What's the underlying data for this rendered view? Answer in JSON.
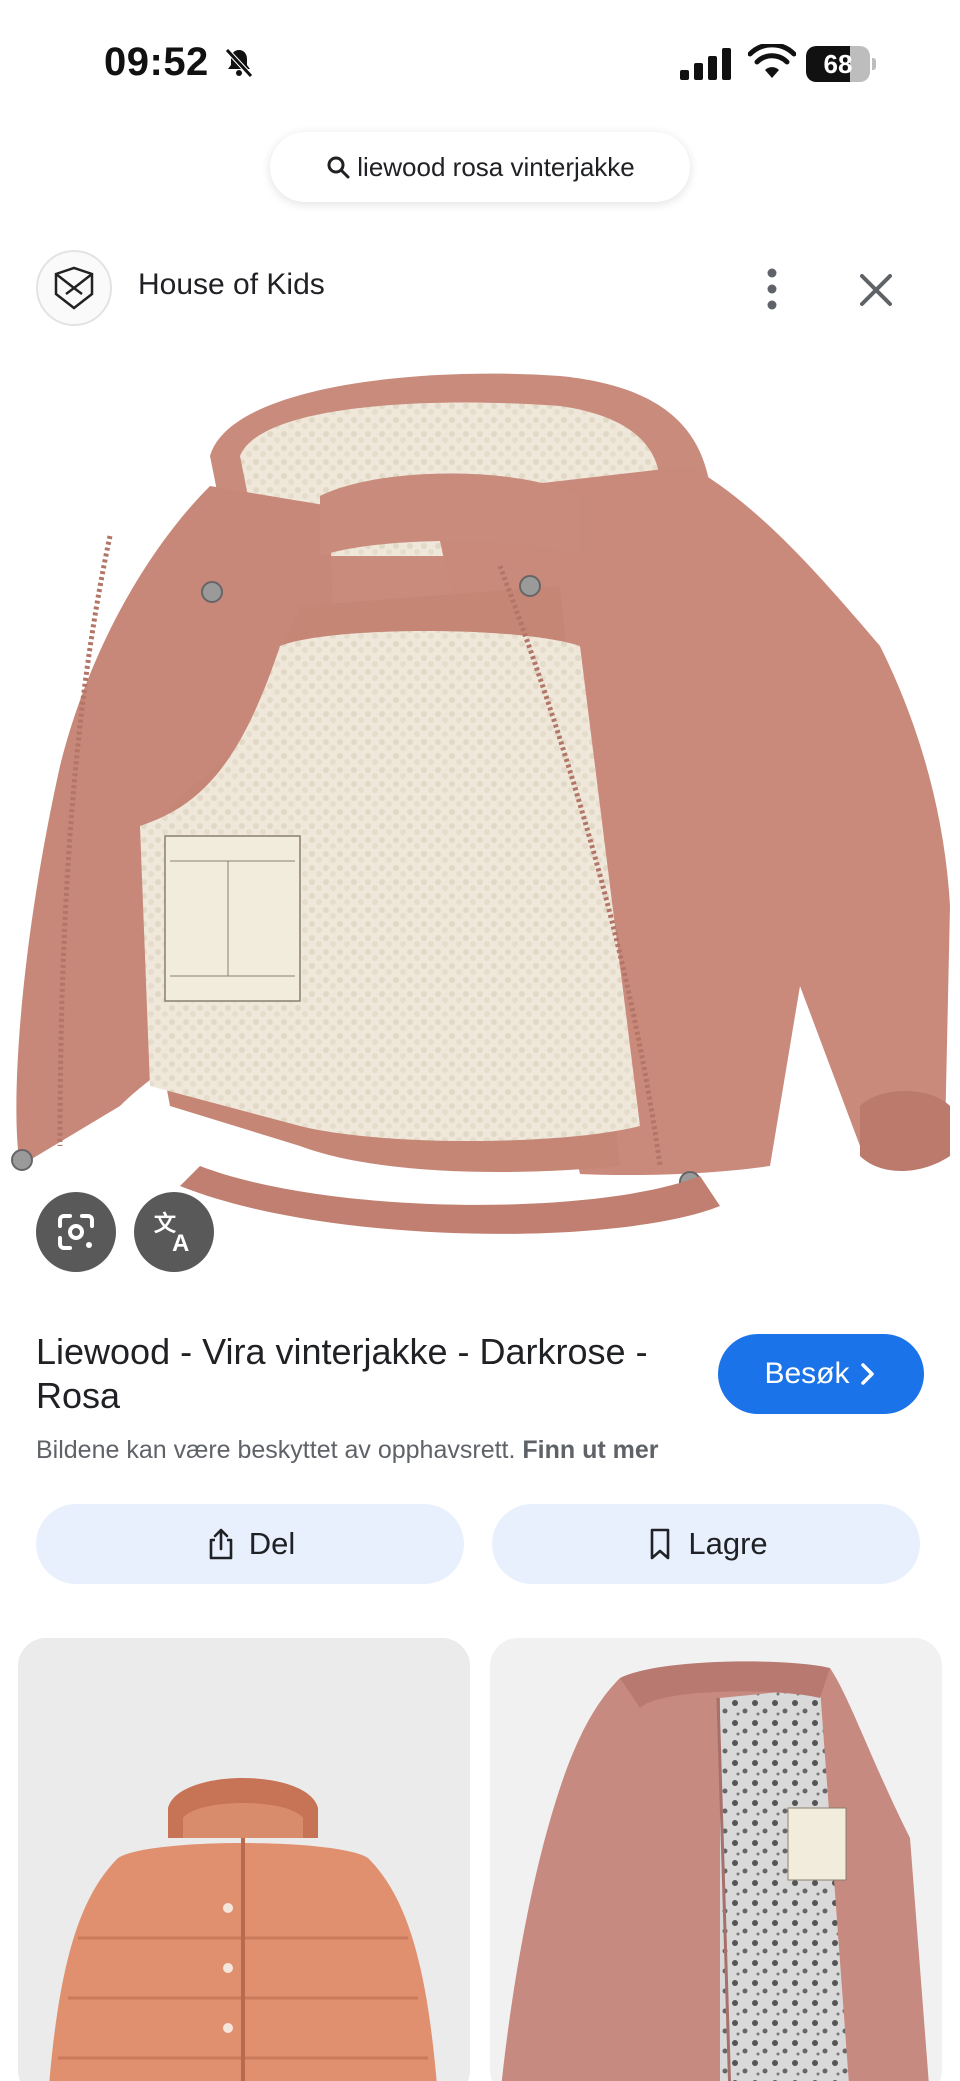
{
  "status_bar": {
    "time": "09:52",
    "battery_percent": "68",
    "battery_level": 0.68
  },
  "search": {
    "query": "liewood rosa vinterjakke"
  },
  "source": {
    "name": "House of Kids"
  },
  "result": {
    "title": "Liewood - Vira vinterjakke - Darkrose - Rosa",
    "visit_label": "Besøk",
    "copyright_text": "Bildene kan være beskyttet av opphavsrett.",
    "learn_more_label": "Finn ut mer"
  },
  "actions": {
    "share_label": "Del",
    "save_label": "Lagre"
  },
  "colors": {
    "accent": "#1a73e8",
    "pill_bg": "#e8f0fe",
    "jacket": "#c98a7b",
    "sherpa": "#eee6d8"
  },
  "icons": {
    "search": "search-icon",
    "more": "more-vert-icon",
    "close": "close-icon",
    "lens": "lens-icon",
    "translate": "translate-icon",
    "share": "share-icon",
    "bookmark": "bookmark-icon",
    "chevron": "chevron-right-icon"
  }
}
